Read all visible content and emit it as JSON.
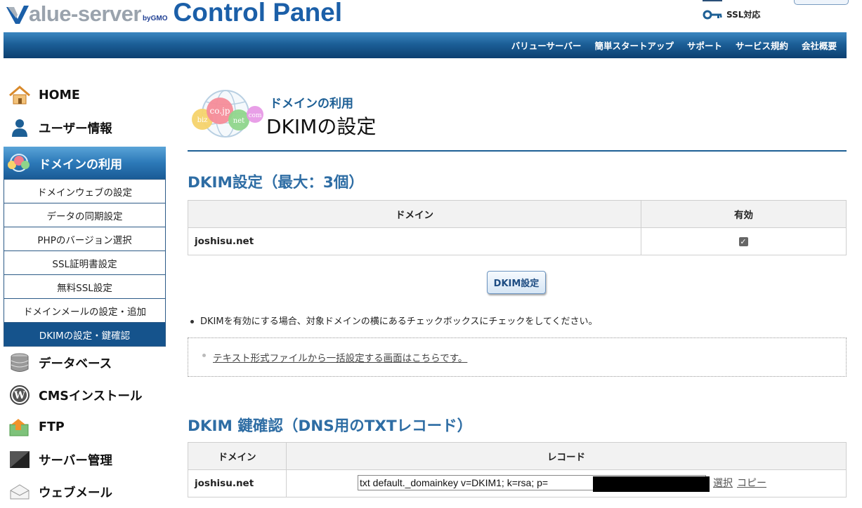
{
  "header": {
    "logo_brand": "alue-server",
    "logo_by": "byGMO",
    "logo_title": "Control Panel",
    "ssl_label": "SSL対応"
  },
  "nav": {
    "items": [
      "バリューサーバー",
      "簡単スタートアップ",
      "サポート",
      "サービス規約",
      "会社概要"
    ]
  },
  "sidebar": {
    "top": [
      {
        "label": "HOME",
        "icon": "home-icon"
      },
      {
        "label": "ユーザー情報",
        "icon": "user-icon"
      }
    ],
    "active": {
      "label": "ドメインの利用",
      "icon": "domain-globe-icon"
    },
    "submenu": [
      "ドメインウェブの設定",
      "データの同期設定",
      "PHPのバージョン選択",
      "SSL証明書設定",
      "無料SSL設定",
      "ドメインメールの設定・追加",
      "DKIMの設定・鍵確認"
    ],
    "bottom": [
      {
        "label": "データベース",
        "icon": "database-icon"
      },
      {
        "label": "CMSインストール",
        "icon": "wordpress-icon"
      },
      {
        "label": "FTP",
        "icon": "ftp-icon"
      },
      {
        "label": "サーバー管理",
        "icon": "server-icon"
      },
      {
        "label": "ウェブメール",
        "icon": "mail-icon"
      }
    ]
  },
  "page": {
    "category": "ドメインの利用",
    "title": "DKIMの設定",
    "globe_tlds": [
      "biz",
      "co.jp",
      "net",
      "com"
    ]
  },
  "dkim_settings": {
    "title": "DKIM設定（最大：3個）",
    "columns": [
      "ドメイン",
      "有効"
    ],
    "rows": [
      {
        "domain": "joshisu.net",
        "enabled": true
      }
    ],
    "button_label": "DKIM設定",
    "note": "DKIMを有効にする場合、対象ドメインの横にあるチェックボックスにチェックをしてください。",
    "bulk_link": "テキスト形式ファイルから一括設定する画面はこちらです。"
  },
  "dkim_keys": {
    "title": "DKIM 鍵確認（DNS用のTXTレコード）",
    "columns": [
      "ドメイン",
      "レコード"
    ],
    "rows": [
      {
        "domain": "joshisu.net",
        "record": "txt default._domainkey v=DKIM1; k=rsa; p="
      }
    ],
    "select_label": "選択",
    "copy_label": "コピー"
  },
  "colors": {
    "accent": "#1d5f95",
    "nav_dark": "#0c3f70",
    "section_title": "#2e6da4",
    "submenu_current": "#15538c"
  }
}
